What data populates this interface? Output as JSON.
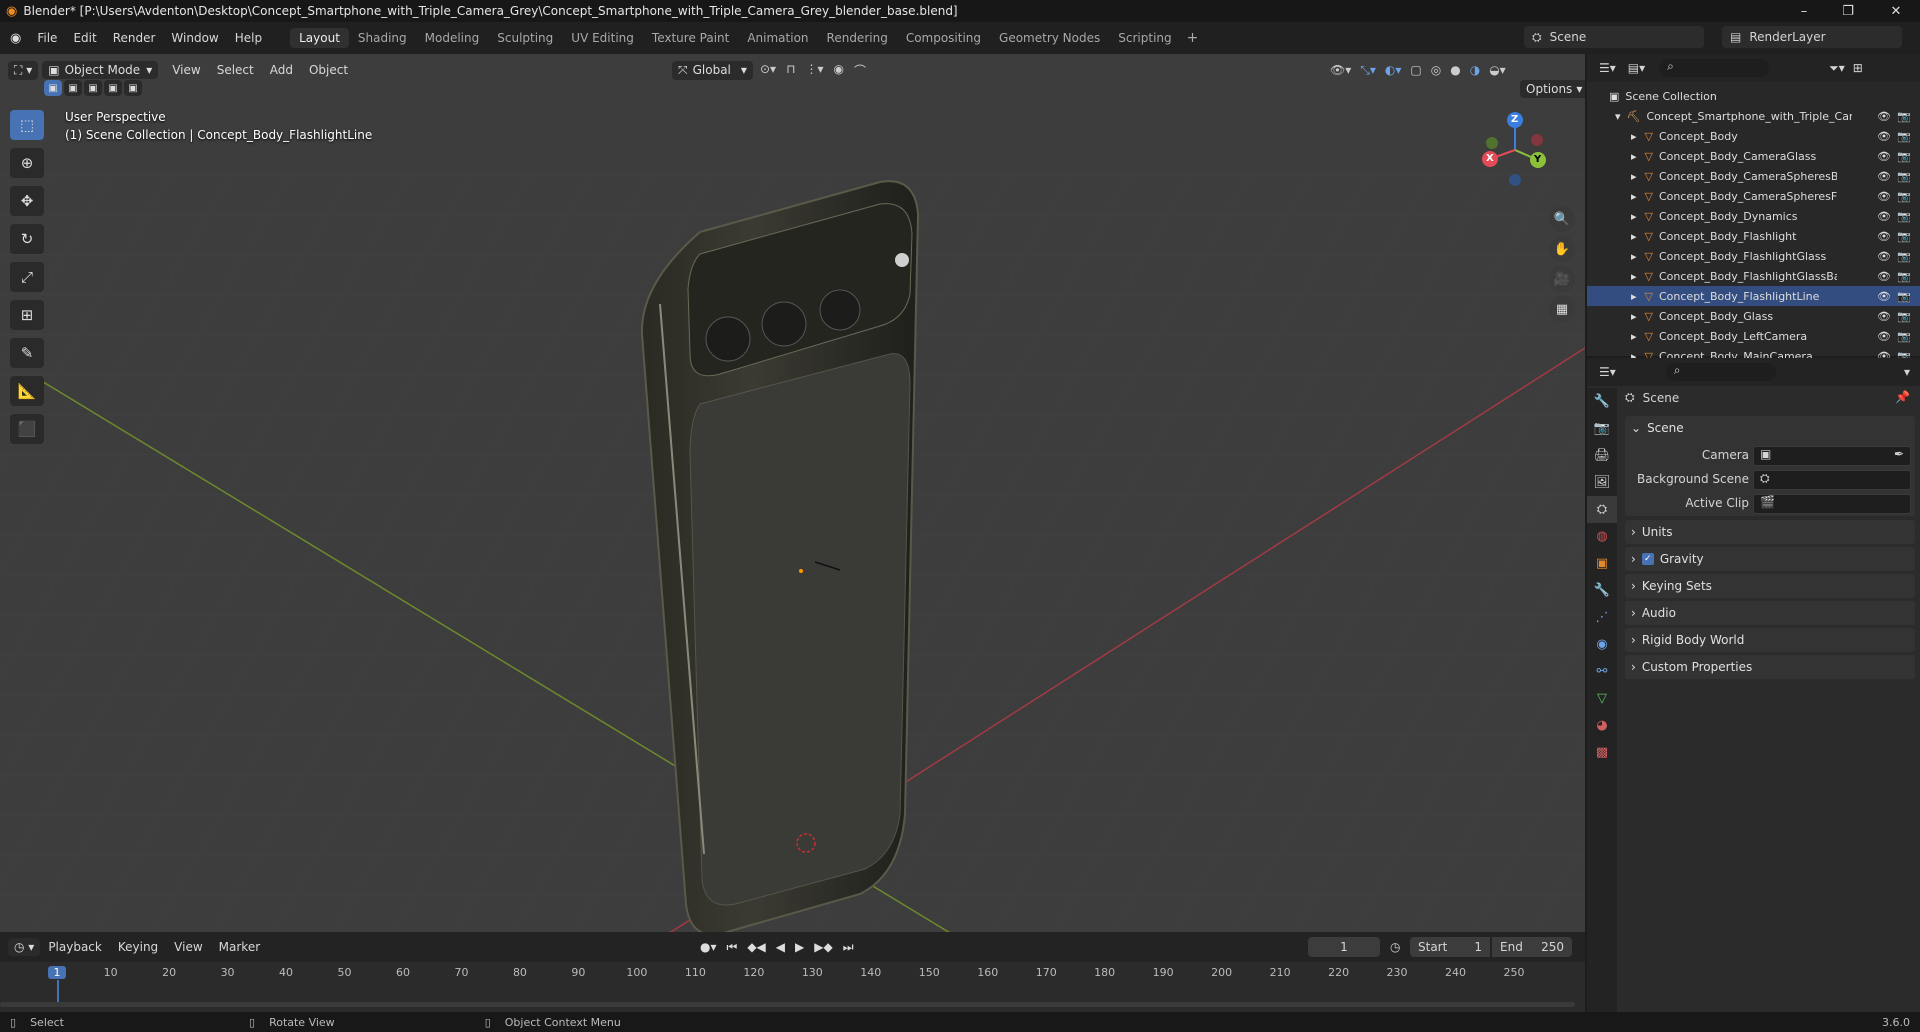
{
  "window": {
    "title": "Blender* [P:\\Users\\Avdenton\\Desktop\\Concept_Smartphone_with_Triple_Camera_Grey\\Concept_Smartphone_with_Triple_Camera_Grey_blender_base.blend]"
  },
  "menus": [
    "File",
    "Edit",
    "Render",
    "Window",
    "Help"
  ],
  "workspaces": [
    "Layout",
    "Shading",
    "Modeling",
    "Sculpting",
    "UV Editing",
    "Texture Paint",
    "Animation",
    "Rendering",
    "Compositing",
    "Geometry Nodes",
    "Scripting"
  ],
  "scene_selector": {
    "scene": "Scene",
    "view_layer": "RenderLayer"
  },
  "viewport": {
    "mode": "Object Mode",
    "menus": [
      "View",
      "Select",
      "Add",
      "Object"
    ],
    "transform_orientation": "Global",
    "options_label": "Options",
    "info_line1": "User Perspective",
    "info_line2": "(1) Scene Collection | Concept_Body_FlashlightLine",
    "gizmo": {
      "z": "Z",
      "y": "Y",
      "x": "X"
    }
  },
  "timeline": {
    "menus": [
      "Playback",
      "Keying",
      "View",
      "Marker"
    ],
    "current_frame": "1",
    "start_label": "Start",
    "start": "1",
    "end_label": "End",
    "end": "250",
    "ruler": [
      "1",
      "10",
      "20",
      "30",
      "40",
      "50",
      "60",
      "70",
      "80",
      "90",
      "100",
      "110",
      "120",
      "130",
      "140",
      "150",
      "160",
      "170",
      "180",
      "190",
      "200",
      "210",
      "220",
      "230",
      "240",
      "250"
    ]
  },
  "outliner": {
    "root": "Scene Collection",
    "collection": "Concept_Smartphone_with_Triple_Came",
    "items": [
      "Concept_Body",
      "Concept_Body_CameraGlass",
      "Concept_Body_CameraSpheresBack",
      "Concept_Body_CameraSpheresFron",
      "Concept_Body_Dynamics",
      "Concept_Body_Flashlight",
      "Concept_Body_FlashlightGlass",
      "Concept_Body_FlashlightGlassBack",
      "Concept_Body_FlashlightLine",
      "Concept_Body_Glass",
      "Concept_Body_LeftCamera",
      "Concept_Body_MainCamera"
    ]
  },
  "properties": {
    "context": "Scene",
    "panel_title": "Scene",
    "camera_label": "Camera",
    "background_scene_label": "Background Scene",
    "active_clip_label": "Active Clip",
    "subpanels": [
      "Units",
      "Gravity",
      "Keying Sets",
      "Audio",
      "Rigid Body World",
      "Custom Properties"
    ]
  },
  "statusbar": {
    "select": "Select",
    "rotate": "Rotate View",
    "context_menu": "Object Context Menu",
    "version": "3.6.0"
  }
}
